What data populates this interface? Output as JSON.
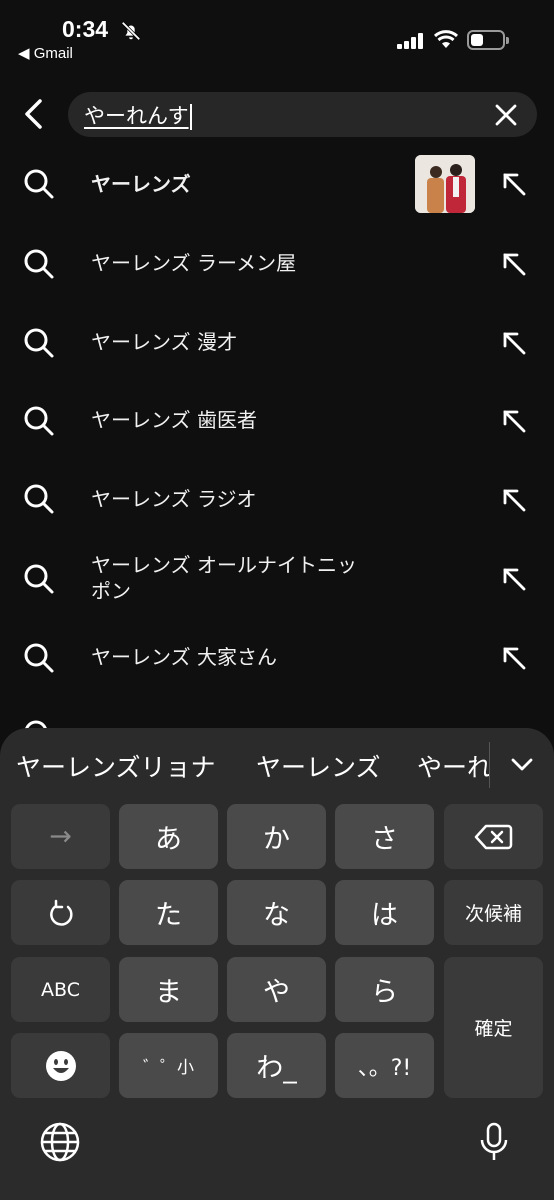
{
  "status_bar": {
    "time": "0:34",
    "back_app": "◀ Gmail",
    "icons": [
      "bell-slash-icon",
      "signal-icon",
      "wifi-icon",
      "battery-icon"
    ]
  },
  "search": {
    "query": "やーれんす",
    "icons": [
      "back-arrow-icon",
      "clear-icon"
    ]
  },
  "suggestions": [
    {
      "text": "ヤーレンズ",
      "bold": true,
      "has_thumbnail": true
    },
    {
      "text": "ヤーレンズ ラーメン屋"
    },
    {
      "text": "ヤーレンズ 漫才"
    },
    {
      "text": "ヤーレンズ 歯医者"
    },
    {
      "text": "ヤーレンズ ラジオ"
    },
    {
      "text": "ヤーレンズ オールナイトニッポン"
    },
    {
      "text": "ヤーレンズ 大家さん"
    }
  ],
  "keyboard": {
    "candidates": [
      "ヤーレンズリョナ",
      "ヤーレンズ",
      "やーれ"
    ],
    "keys": {
      "arrow": "→",
      "a": "あ",
      "ka": "か",
      "sa": "さ",
      "undo": "↺",
      "ta": "た",
      "na": "な",
      "ha": "は",
      "next_candidate": "次候補",
      "abc": "ABC",
      "ma": "ま",
      "ya": "や",
      "ra": "ら",
      "confirm": "確定",
      "dakuten": "゛゜小",
      "wa": "わ_",
      "punct": "、。?!"
    },
    "icons": [
      "backspace-icon",
      "emoji-icon",
      "globe-icon",
      "microphone-icon",
      "chevron-down-icon"
    ]
  },
  "colors": {
    "background": "#0f0f0f",
    "search_box": "#272727",
    "keyboard_bg": "#2b2b2b",
    "key": "#4a4a4a",
    "text": "#f1f1f1"
  }
}
